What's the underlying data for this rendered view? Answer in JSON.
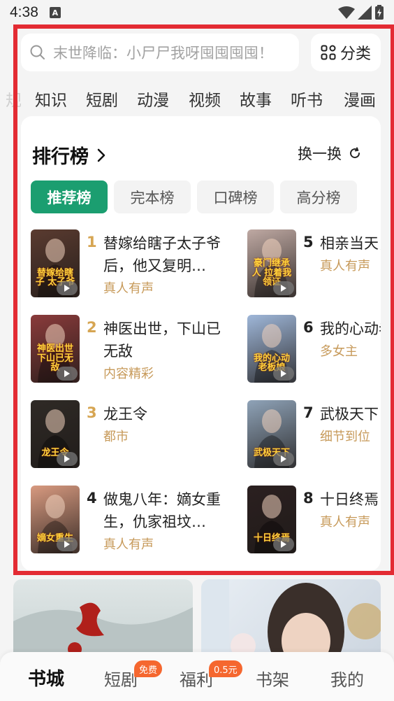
{
  "status_bar": {
    "time": "4:38",
    "notification_letter": "A"
  },
  "search": {
    "placeholder": "末世降临：小尸尸我呀囤囤囤囤！"
  },
  "category_button": {
    "label": "分类"
  },
  "channel_tabs": [
    "知识",
    "短剧",
    "动漫",
    "视频",
    "故事",
    "听书",
    "漫画"
  ],
  "ghost_tab_char": "规",
  "ranking": {
    "title": "排行榜",
    "refresh_label": "换一换",
    "tabs": [
      "推荐榜",
      "完本榜",
      "口碑榜",
      "高分榜"
    ],
    "active_tab": 0,
    "books": [
      {
        "rank": "1",
        "title": "替嫁给瞎子太子爷后，他又复明…",
        "tag": "真人有声",
        "cover_text": "替嫁给瞎子 太子爷",
        "cover_color": "#5a3b30"
      },
      {
        "rank": "2",
        "title": "神医出世，下山已无敌",
        "tag": "内容精彩",
        "cover_text": "神医出世 下山已无敌",
        "cover_color": "#8a3b3b"
      },
      {
        "rank": "3",
        "title": "龙王令",
        "tag": "都市",
        "cover_text": "龙王令",
        "cover_color": "#2f2a26"
      },
      {
        "rank": "4",
        "title": "做鬼八年：嫡女重生，仇家祖坟…",
        "tag": "真人有声",
        "cover_text": "嫡女重生",
        "cover_color": "#d89a80"
      },
      {
        "rank": "5",
        "title": "相亲当天，豪门继承人拉着我领证",
        "tag": "真人有声",
        "cover_text": "豪门继承人 拉着我领证",
        "cover_color": "#bfa9a3"
      },
      {
        "rank": "6",
        "title": "我的心动老板娘",
        "tag": "多女主",
        "cover_text": "我的心动 老板娘",
        "cover_color": "#9fb7d9"
      },
      {
        "rank": "7",
        "title": "武极天下",
        "tag": "细节到位",
        "cover_text": "武极天下",
        "cover_color": "#8fa3b8"
      },
      {
        "rank": "8",
        "title": "十日终焉",
        "tag": "真人有声",
        "cover_text": "十日终焉",
        "cover_color": "#2b2020"
      }
    ]
  },
  "bottom_nav": {
    "items": [
      "书城",
      "短剧",
      "福利",
      "书架",
      "我的"
    ],
    "active": 0,
    "badge_free": "免费",
    "badge_reward": "0.5元"
  },
  "colors": {
    "accent_green": "#1b9e70",
    "highlight_red": "#e32b33",
    "rank_top3": "#d6a552",
    "rank_other": "#222222",
    "tag_gold": "#c79a5a",
    "badge_orange": "#f5672f"
  }
}
